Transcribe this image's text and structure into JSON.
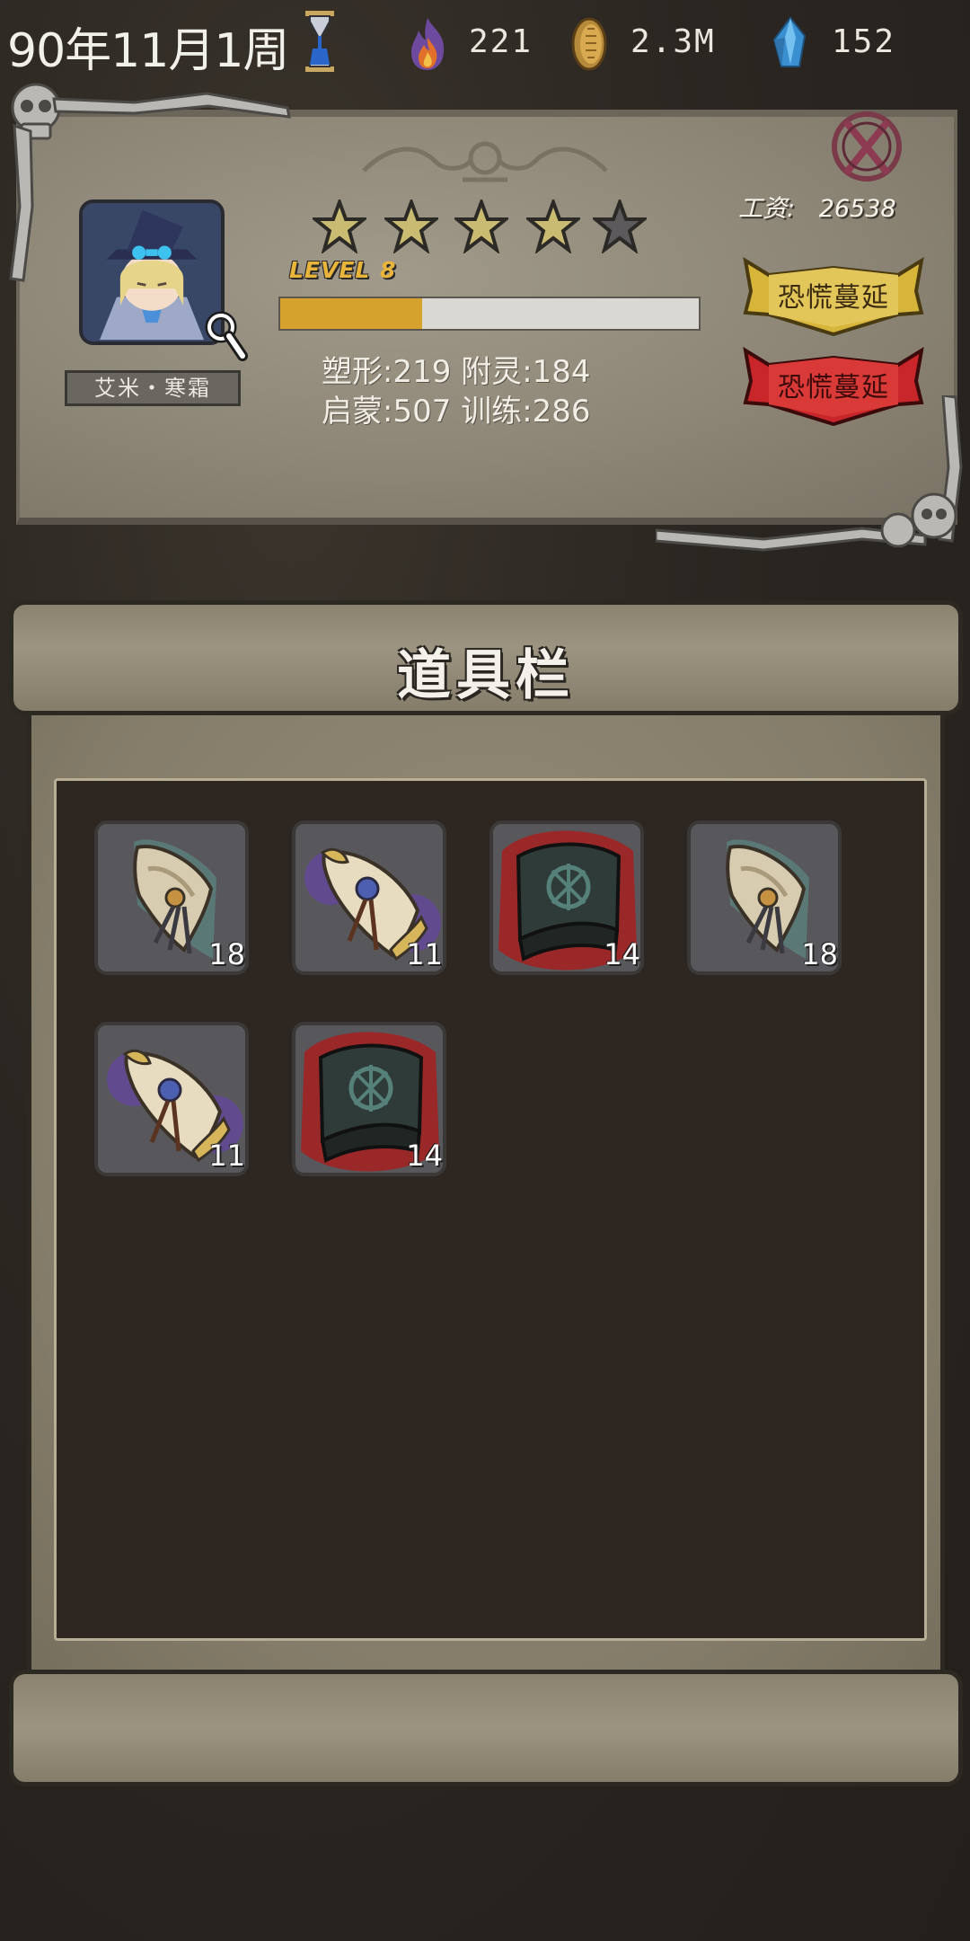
{
  "status_bar": {
    "date": "90年11月1周",
    "resources": [
      {
        "name": "soul-fire",
        "icon": "fire-icon",
        "value": "221"
      },
      {
        "name": "gold",
        "icon": "coin-icon",
        "value": "2.3M"
      },
      {
        "name": "crystal",
        "icon": "crystal-icon",
        "value": "152"
      }
    ]
  },
  "character": {
    "name": "艾米・寒霜",
    "stars_total": 5,
    "stars_filled": 4,
    "level_label": "LEVEL",
    "level": "8",
    "exp_fraction": 0.34,
    "stats": [
      {
        "label": "塑形",
        "value": "219"
      },
      {
        "label": "附灵",
        "value": "184"
      },
      {
        "label": "启蒙",
        "value": "507"
      },
      {
        "label": "训练",
        "value": "286"
      }
    ],
    "salary_label": "工资:",
    "salary_value": "26538",
    "buttons": [
      {
        "label": "恐慌蔓延",
        "color": "#d7b53a",
        "text_color": "#3a2a10"
      },
      {
        "label": "恐慌蔓延",
        "color": "#c8262a",
        "text_color": "#3b0a0a"
      }
    ]
  },
  "inventory": {
    "title": "道具栏",
    "items": [
      {
        "kind": "scroll-teal",
        "count": "18"
      },
      {
        "kind": "scroll-purple",
        "count": "11"
      },
      {
        "kind": "scroll-blood",
        "count": "14"
      },
      {
        "kind": "scroll-teal",
        "count": "18"
      },
      {
        "kind": "scroll-purple",
        "count": "11"
      },
      {
        "kind": "scroll-blood",
        "count": "14"
      }
    ]
  },
  "colors": {
    "exp_fill": "#d6a22e",
    "star_filled": "#c9bb72",
    "star_empty": "#5c5a5c",
    "level_text": "#e8b43a"
  }
}
